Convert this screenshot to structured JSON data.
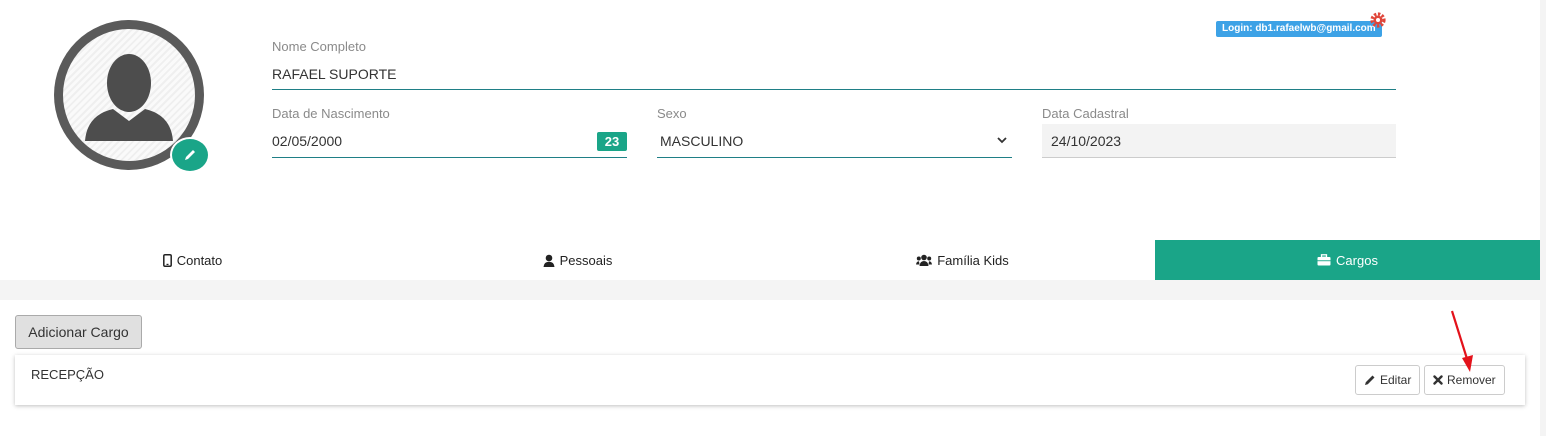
{
  "header": {
    "login_badge": "Login: db1.rafaelwb@gmail.com",
    "accent_color": "#1aa588"
  },
  "profile": {
    "nome_label": "Nome Completo",
    "nome_value": "RAFAEL SUPORTE",
    "nascimento_label": "Data de Nascimento",
    "nascimento_value": "02/05/2000",
    "nascimento_calendar_badge": "23",
    "sexo_label": "Sexo",
    "sexo_value": "MASCULINO",
    "cadastral_label": "Data Cadastral",
    "cadastral_value": "24/10/2023"
  },
  "tabs": [
    {
      "label": "Contato",
      "icon": "mobile-icon",
      "active": false
    },
    {
      "label": "Pessoais",
      "icon": "user-icon",
      "active": false
    },
    {
      "label": "Família Kids",
      "icon": "users-icon",
      "active": false
    },
    {
      "label": "Cargos",
      "icon": "briefcase-icon",
      "active": true
    }
  ],
  "cargos": {
    "add_button": "Adicionar Cargo",
    "items": [
      {
        "name": "RECEPÇÃO",
        "edit_label": "Editar",
        "remove_label": "Remover"
      }
    ]
  }
}
